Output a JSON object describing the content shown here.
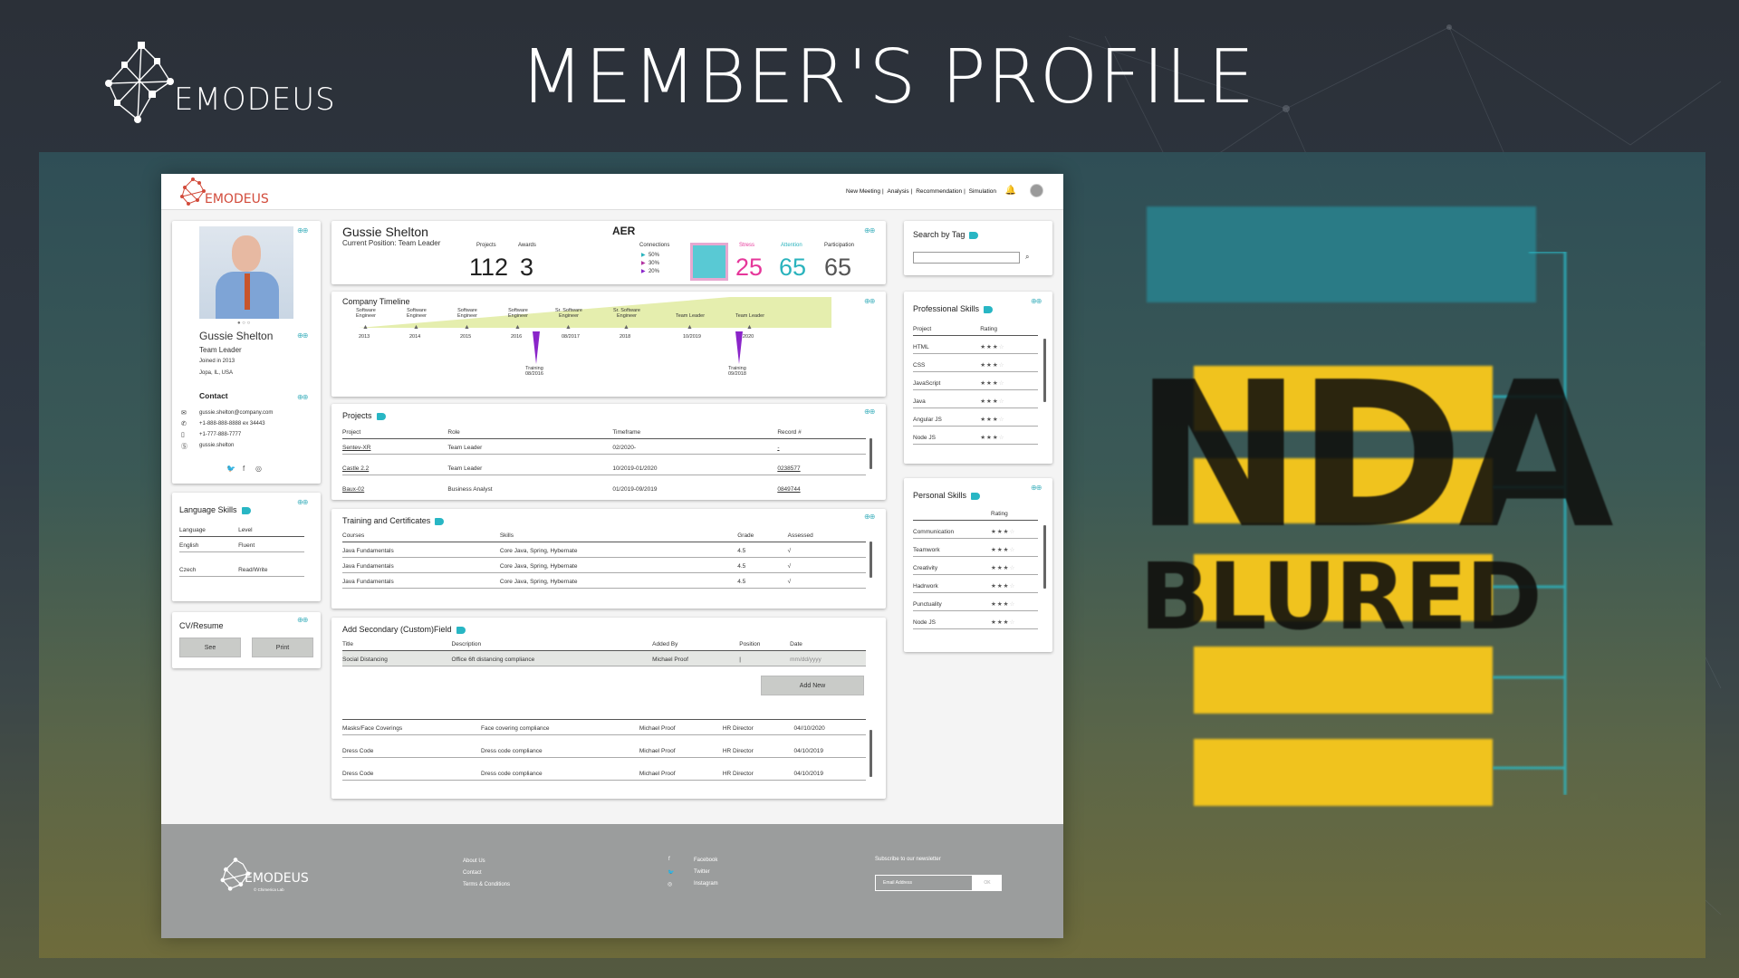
{
  "header": {
    "brand": "EMODEUS",
    "title": "MEMBER'S PROFILE"
  },
  "app": {
    "brand": "EMODEUS",
    "nav": [
      "New Meeting",
      "Analysis",
      "Recommendation",
      "Simulation"
    ],
    "profile": {
      "name": "Gussie Shelton",
      "role": "Team Leader",
      "joined": "Joined in 2013",
      "location": "Jopa, IL, USA",
      "contact_title": "Contact",
      "email": "gussie.shelton@company.com",
      "phone1": "+1-888-888-8888 ex 34443",
      "phone2": "+1-777-888-7777",
      "skype": "gussie.shelton"
    },
    "languages": {
      "title": "Language Skills",
      "headers": [
        "Language",
        "Level"
      ],
      "rows": [
        [
          "English",
          "Fluent"
        ],
        [
          "Czech",
          "Read/Write"
        ]
      ]
    },
    "cv": {
      "title": "CV/Resume",
      "see": "See",
      "print": "Print"
    },
    "summary": {
      "name": "Gussie Shelton",
      "position": "Current Position:  Team Leader",
      "projects_label": "Projects",
      "projects": "112",
      "awards_label": "Awards",
      "awards": "3",
      "aer": "AER",
      "connections_label": "Connections",
      "connections": [
        "50%",
        "30%",
        "20%"
      ],
      "stress_label": "Stress",
      "stress": "25",
      "attention_label": "Attention",
      "attention": "65",
      "participation_label": "Participation",
      "participation": "65"
    },
    "timeline": {
      "title": "Company Timeline",
      "roles": [
        "Software\nEngineer",
        "Software\nEngineer",
        "Software\nEngineer",
        "Software\nEngineer",
        "Sr. Software\nEngineer",
        "Sr. Software\nEngineer",
        "Team Leader",
        "Team Leader"
      ],
      "dates": [
        "2013",
        "2014",
        "2015",
        "2016",
        "08/2017",
        "2018",
        "10/2019",
        "2020"
      ],
      "trainings": [
        [
          "Training",
          "08/2016"
        ],
        [
          "Training",
          "09/2018"
        ]
      ]
    },
    "projects": {
      "title": "Projects",
      "headers": [
        "Project",
        "Role",
        "Timeframe",
        "Record #"
      ],
      "rows": [
        [
          "Sentev-XR",
          "Team Leader",
          "02/2020-",
          "-"
        ],
        [
          "Castle 2.2",
          "Team Leader",
          "10/2019-01/2020",
          "0238577"
        ],
        [
          "Baux-02",
          "Business Analyst",
          "01/2019-09/2019",
          "0849744"
        ]
      ]
    },
    "training": {
      "title": "Training and Certificates",
      "headers": [
        "Courses",
        "Skills",
        "Grade",
        "Assessed"
      ],
      "rows": [
        [
          "Java Fundamentals",
          "Core Java, Spring, Hybernate",
          "4.5",
          "√"
        ],
        [
          "Java Fundamentals",
          "Core Java, Spring, Hybernate",
          "4.5",
          "√"
        ],
        [
          "Java Fundamentals",
          "Core Java, Spring, Hybernate",
          "4.5",
          "√"
        ]
      ]
    },
    "custom": {
      "title": "Add Secondary (Custom)Field",
      "headers": [
        "Title",
        "Description",
        "Added By",
        "Position",
        "Date"
      ],
      "input_row": [
        "Social Distancing",
        "Office 6ft distancing compliance",
        "Michael Proof",
        "|",
        "mm/dd/yyyy"
      ],
      "add_new": "Add New",
      "rows": [
        [
          "Masks/Face Coverings",
          "Face covering compliance",
          "Michael Proof",
          "HR Director",
          "04//10/2020"
        ],
        [
          "Dress Code",
          "Dress code compliance",
          "Michael Proof",
          "HR Director",
          "04/10/2019"
        ],
        [
          "Dress Code",
          "Dress code compliance",
          "Michael Proof",
          "HR Director",
          "04/10/2019"
        ]
      ]
    },
    "search": {
      "title": "Search by Tag"
    },
    "pro_skills": {
      "title": "Professional Skills",
      "headers": [
        "Project",
        "Rating"
      ],
      "rows": [
        [
          "HTML",
          3
        ],
        [
          "CSS",
          3
        ],
        [
          "JavaScript",
          3
        ],
        [
          "Java",
          3
        ],
        [
          "Angular JS",
          3
        ],
        [
          "Node JS",
          3
        ]
      ]
    },
    "personal_skills": {
      "title": "Personal Skills",
      "headers": [
        "",
        "Rating"
      ],
      "rows": [
        [
          "Communication",
          3
        ],
        [
          "Teamwork",
          3
        ],
        [
          "Creativity",
          3
        ],
        [
          "Hadrwork",
          3
        ],
        [
          "Punctuality",
          3
        ],
        [
          "Node JS",
          3
        ]
      ]
    },
    "footer": {
      "brand": "EMODEUS",
      "sub": "© Chimerica Lab",
      "links": [
        "About Us",
        "Contact",
        "Terms & Conditions"
      ],
      "social": [
        "Facebook",
        "Twitter",
        "Instagram"
      ],
      "newsletter": "Subscribe to our newsletter",
      "email_placeholder": "Email Address",
      "ok": "OK"
    }
  },
  "nda": {
    "word1": "NDA",
    "word2": "BLURED"
  },
  "colors": {
    "stress": "#e6369a",
    "attention": "#2ab3bd",
    "accent": "#28b6c4",
    "purple": "#8a25c9",
    "yellow": "#f0c31e"
  }
}
